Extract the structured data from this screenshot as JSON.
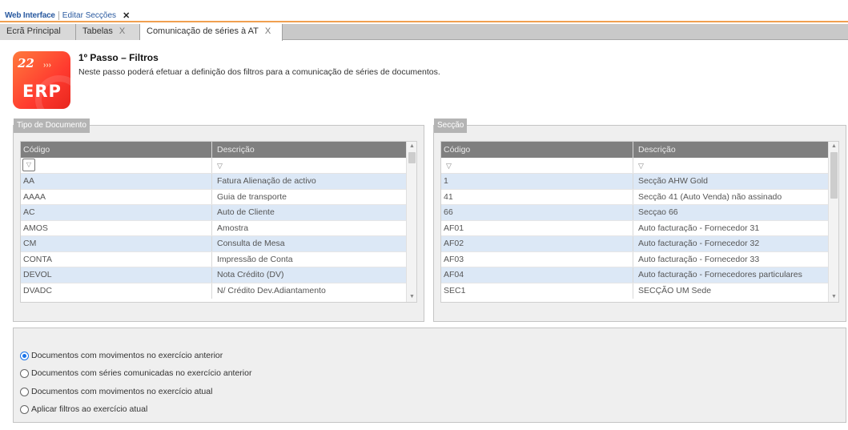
{
  "topbar": {
    "app_name": "Web Interface",
    "link": "Editar Secções",
    "close": "✕"
  },
  "tabs": [
    {
      "label": "Ecrã Principal",
      "close": ""
    },
    {
      "label": "Tabelas",
      "close": "X"
    },
    {
      "label": "Comunicação de séries à AT",
      "close": "X"
    }
  ],
  "header": {
    "logo_text": "ERP",
    "logo_badge": "22",
    "title": "1º Passo – Filtros",
    "description": "Neste passo poderá efetuar a definição dos filtros para a comunicação de séries de documentos."
  },
  "doc_type": {
    "label": "Tipo de Documento",
    "columns": [
      "Código",
      "Descrição"
    ],
    "rows": [
      {
        "code": "AA",
        "desc": "Fatura Alienação de activo"
      },
      {
        "code": "AAAA",
        "desc": "Guia de transporte"
      },
      {
        "code": "AC",
        "desc": "Auto de Cliente"
      },
      {
        "code": "AMOS",
        "desc": "Amostra"
      },
      {
        "code": "CM",
        "desc": "Consulta de Mesa"
      },
      {
        "code": "CONTA",
        "desc": "Impressão de Conta"
      },
      {
        "code": "DEVOL",
        "desc": "Nota Crédito (DV)"
      },
      {
        "code": "DVADC",
        "desc": "N/ Crédito Dev.Adiantamento"
      }
    ]
  },
  "section": {
    "label": "Secção",
    "columns": [
      "Código",
      "Descrição"
    ],
    "rows": [
      {
        "code": "1",
        "desc": "Secção AHW Gold"
      },
      {
        "code": "41",
        "desc": "Secção 41 (Auto Venda) não assinado"
      },
      {
        "code": "66",
        "desc": "Secçao 66"
      },
      {
        "code": "AF01",
        "desc": "Auto facturação - Fornecedor 31"
      },
      {
        "code": "AF02",
        "desc": "Auto facturação - Fornecedor 32"
      },
      {
        "code": "AF03",
        "desc": "Auto facturação - Fornecedor 33"
      },
      {
        "code": "AF04",
        "desc": "Auto facturação - Fornecedores particulares"
      },
      {
        "code": "SEC1",
        "desc": "SECÇÃO UM Sede"
      }
    ]
  },
  "options": [
    {
      "label": "Documentos com movimentos no exercício anterior",
      "selected": true
    },
    {
      "label": "Documentos com séries comunicadas no exercício anterior",
      "selected": false
    },
    {
      "label": "Documentos com movimentos no exercício atual",
      "selected": false
    },
    {
      "label": "Aplicar filtros ao exercício atual",
      "selected": false
    }
  ]
}
